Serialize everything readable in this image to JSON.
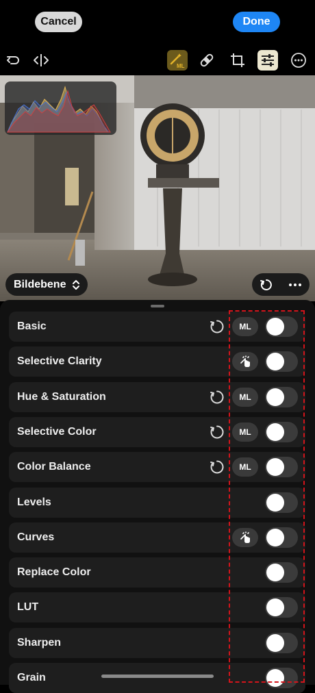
{
  "header": {
    "cancel_label": "Cancel",
    "done_label": "Done"
  },
  "toolbar": {
    "tools": [
      {
        "name": "undo-icon"
      },
      {
        "name": "compare-split-icon"
      },
      {
        "name": "ml-magic-wand-icon",
        "badge": "ML"
      },
      {
        "name": "bandage-heal-icon"
      },
      {
        "name": "crop-icon"
      },
      {
        "name": "adjustments-sliders-icon",
        "active": true
      },
      {
        "name": "more-circle-icon"
      }
    ]
  },
  "photo": {
    "layer_selector_label": "Bildebene"
  },
  "adjustments": {
    "items": [
      {
        "label": "Basic",
        "reset": true,
        "badge": "ML",
        "enabled": false
      },
      {
        "label": "Selective Clarity",
        "reset": false,
        "badge": "hand",
        "enabled": false
      },
      {
        "label": "Hue & Saturation",
        "reset": true,
        "badge": "ML",
        "enabled": false
      },
      {
        "label": "Selective Color",
        "reset": true,
        "badge": "ML",
        "enabled": false
      },
      {
        "label": "Color Balance",
        "reset": true,
        "badge": "ML",
        "enabled": false
      },
      {
        "label": "Levels",
        "reset": false,
        "badge": "",
        "enabled": false
      },
      {
        "label": "Curves",
        "reset": false,
        "badge": "hand",
        "enabled": false
      },
      {
        "label": "Replace Color",
        "reset": false,
        "badge": "",
        "enabled": false
      },
      {
        "label": "LUT",
        "reset": false,
        "badge": "",
        "enabled": false
      },
      {
        "label": "Sharpen",
        "reset": false,
        "badge": "",
        "enabled": false
      },
      {
        "label": "Grain",
        "reset": false,
        "badge": "",
        "enabled": false
      }
    ]
  },
  "colors": {
    "accent_blue": "#1e86f5",
    "highlight_dashed": "#d4141b",
    "ml_tool_gold": "#e5b52a"
  }
}
